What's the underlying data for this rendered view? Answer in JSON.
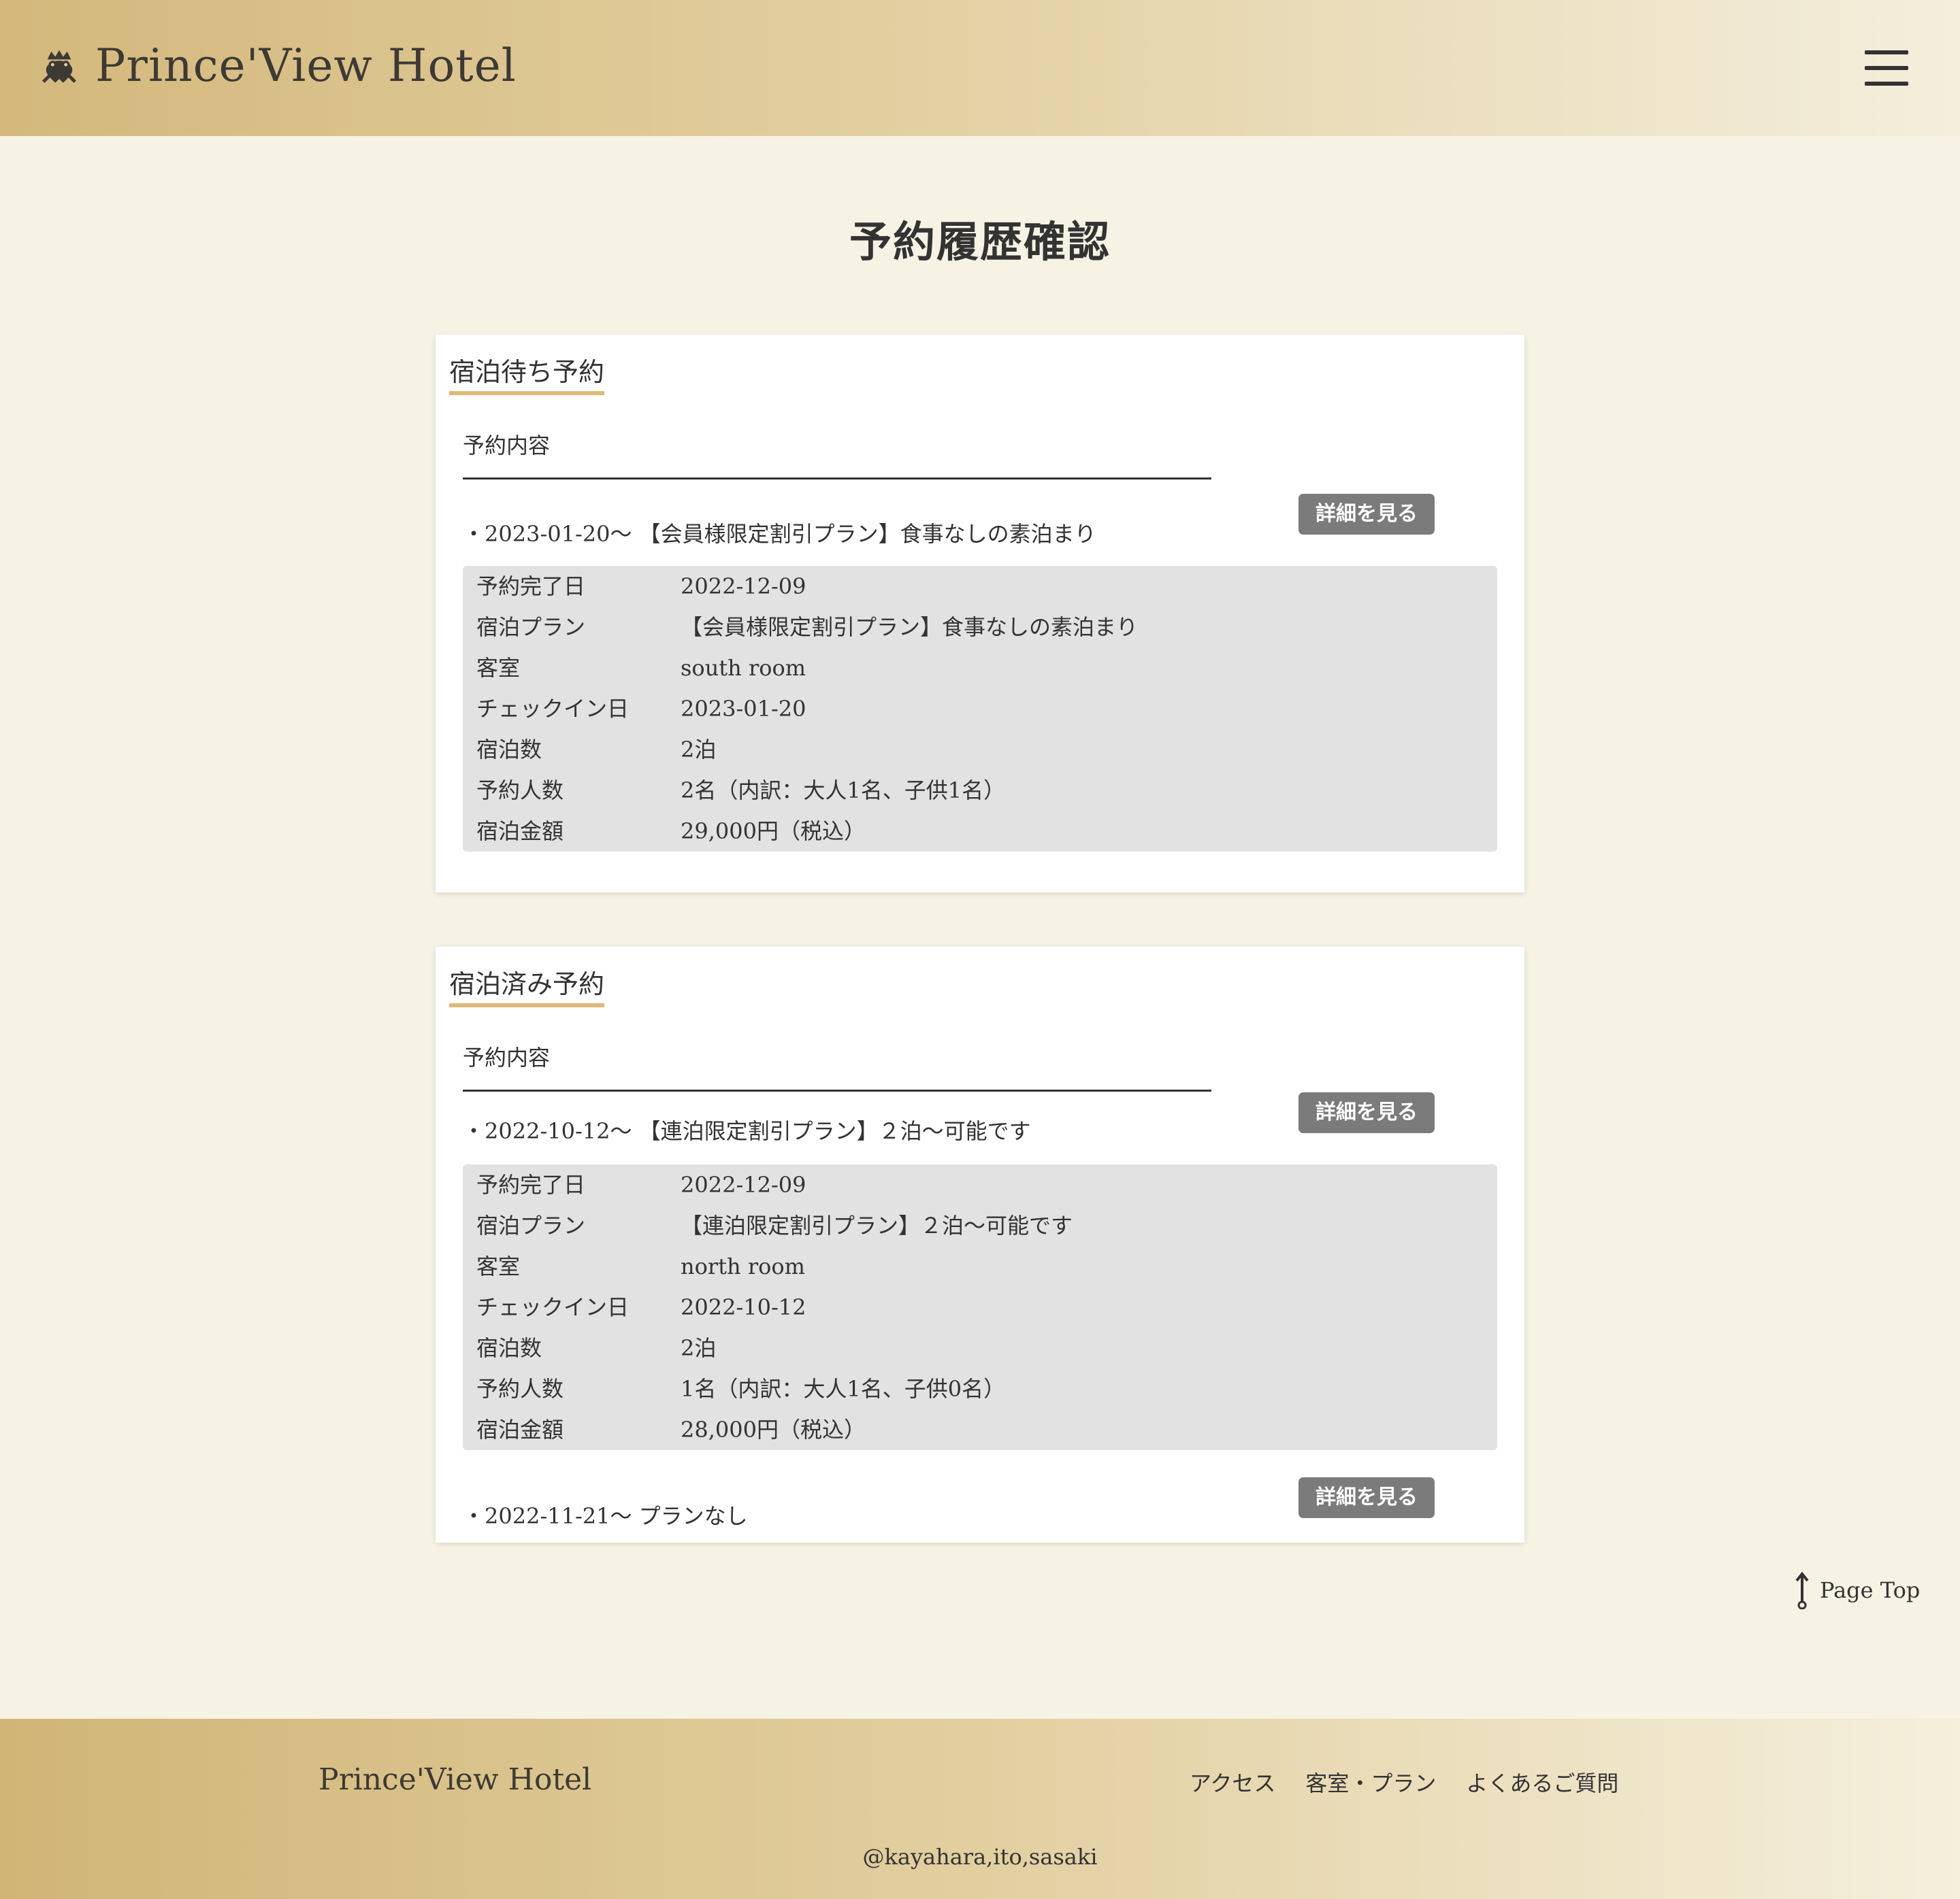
{
  "header": {
    "brand": "Prince'View Hotel",
    "logo_icon": "frog-crown-icon",
    "menu_icon": "hamburger-menu-icon"
  },
  "page_title": "予約履歴確認",
  "waiting": {
    "title": "宿泊待ち予約",
    "sub_label": "予約内容",
    "reservations": [
      {
        "line": "・2023-01-20～ 【会員様限定割引プラン】食事なしの素泊まり",
        "button": "詳細を見る",
        "details": [
          {
            "k": "予約完了日",
            "v": "2022-12-09"
          },
          {
            "k": "宿泊プラン",
            "v": "【会員様限定割引プラン】食事なしの素泊まり"
          },
          {
            "k": "客室",
            "v": "south room"
          },
          {
            "k": "チェックイン日",
            "v": "2023-01-20"
          },
          {
            "k": "宿泊数",
            "v": "2泊"
          },
          {
            "k": "予約人数",
            "v": "2名（内訳：大人1名、子供1名）"
          },
          {
            "k": "宿泊金額",
            "v": "29,000円（税込）"
          }
        ]
      }
    ]
  },
  "done": {
    "title": "宿泊済み予約",
    "sub_label": "予約内容",
    "reservations": [
      {
        "line": "・2022-10-12～ 【連泊限定割引プラン】２泊～可能です",
        "button": "詳細を見る",
        "details": [
          {
            "k": "予約完了日",
            "v": "2022-12-09"
          },
          {
            "k": "宿泊プラン",
            "v": "【連泊限定割引プラン】２泊～可能です"
          },
          {
            "k": "客室",
            "v": "north room"
          },
          {
            "k": "チェックイン日",
            "v": "2022-10-12"
          },
          {
            "k": "宿泊数",
            "v": "2泊"
          },
          {
            "k": "予約人数",
            "v": "1名（内訳：大人1名、子供0名）"
          },
          {
            "k": "宿泊金額",
            "v": "28,000円（税込）"
          }
        ]
      },
      {
        "line": "・2022-11-21～ プランなし",
        "button": "詳細を見る"
      }
    ]
  },
  "page_top": {
    "label": "Page Top",
    "icon": "arrow-up-icon"
  },
  "footer": {
    "brand": "Prince'View Hotel",
    "nav": [
      "アクセス",
      "客室・プラン",
      "よくあるご質問"
    ],
    "copyright": "@kayahara,ito,sasaki"
  }
}
